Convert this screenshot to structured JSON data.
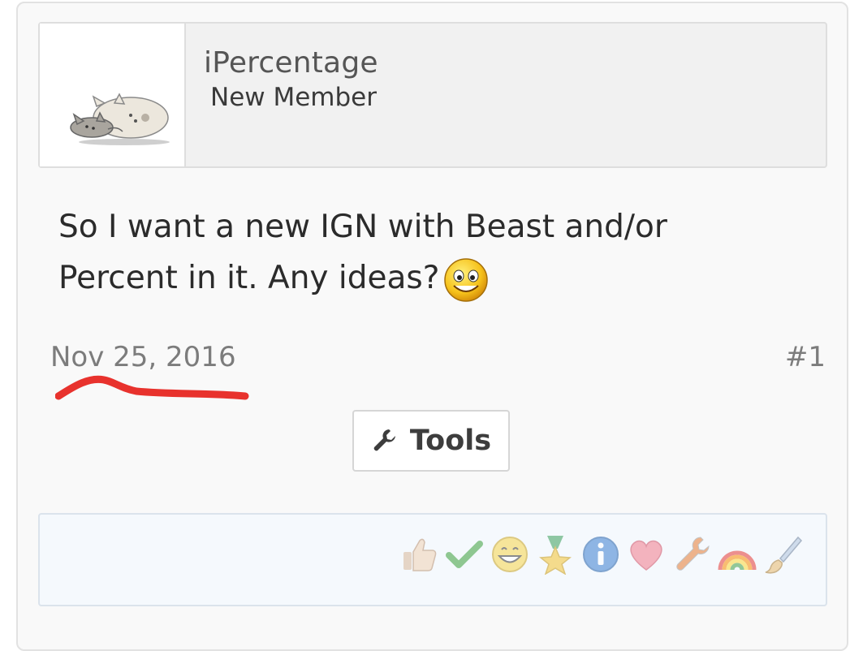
{
  "user": {
    "name": "iPercentage",
    "title": "New Member"
  },
  "post": {
    "message_line1": "So I want a new IGN with Beast and/or",
    "message_line2": "Percent in it. Any ideas?",
    "date": "Nov 25, 2016",
    "number": "#1"
  },
  "tools": {
    "label": "Tools",
    "icon": "wrench-icon"
  },
  "reactions": [
    "thumbs-up-icon",
    "checkmark-icon",
    "grin-icon",
    "medal-star-icon",
    "info-icon",
    "heart-icon",
    "wrench-icon",
    "rainbow-icon",
    "paintbrush-icon"
  ],
  "colors": {
    "underline_annotation": "#e8322d",
    "card_background": "#f9f9f9",
    "reactions_background": "#f5f9fd"
  }
}
